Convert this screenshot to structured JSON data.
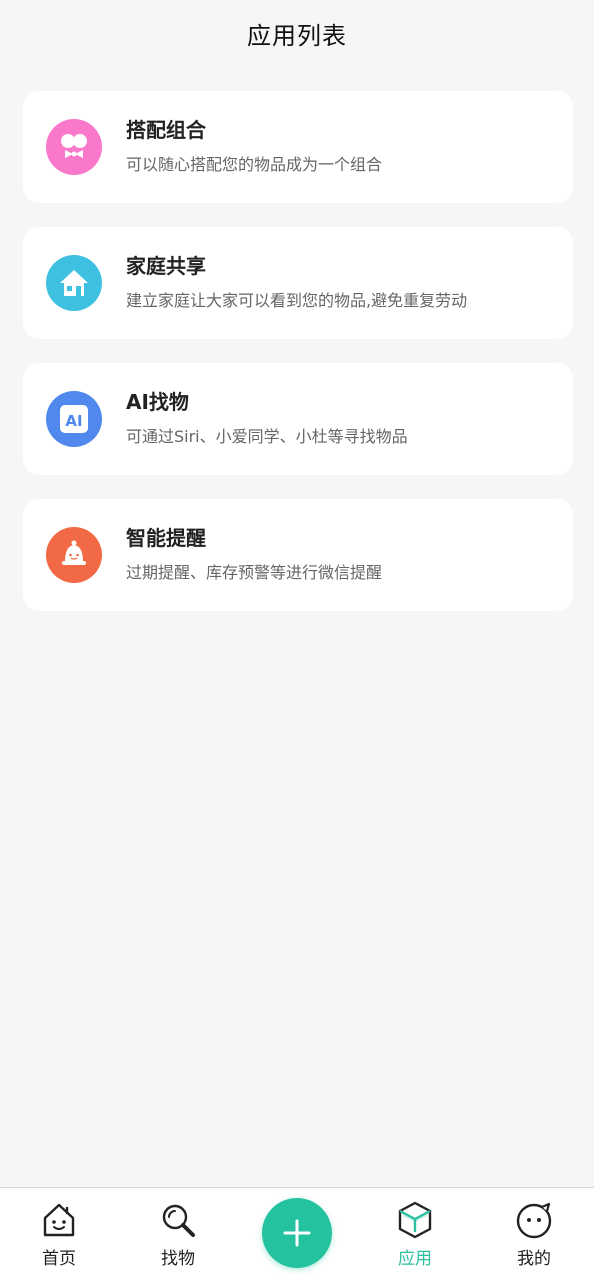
{
  "header": {
    "title": "应用列表"
  },
  "apps": [
    {
      "name": "搭配组合",
      "desc": "可以随心搭配您的物品成为一个组合",
      "icon": "bowtie-icon",
      "color": "#f978c9"
    },
    {
      "name": "家庭共享",
      "desc": "建立家庭让大家可以看到您的物品,避免重复劳动",
      "icon": "house-icon",
      "color": "#3ec0e0"
    },
    {
      "name": "AI找物",
      "desc": "可通过Siri、小爱同学、小杜等寻找物品",
      "icon": "ai-icon",
      "color": "#5088ee"
    },
    {
      "name": "智能提醒",
      "desc": "过期提醒、库存预警等进行微信提醒",
      "icon": "bell-icon",
      "color": "#f26a45"
    }
  ],
  "tabbar": {
    "home": "首页",
    "find": "找物",
    "add": "add-icon",
    "apps": "应用",
    "mine": "我的",
    "active_color": "#2bbfa0"
  }
}
